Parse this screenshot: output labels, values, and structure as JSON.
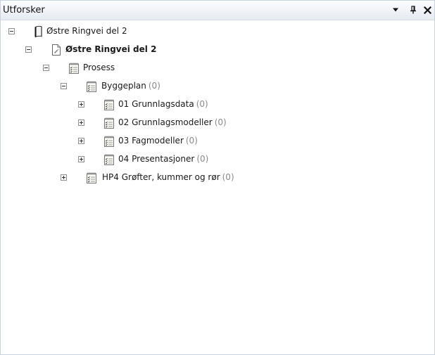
{
  "panel": {
    "title": "Utforsker",
    "icons": [
      "dropdown-arrow-icon",
      "pin-icon",
      "close-icon"
    ]
  },
  "tree": [
    {
      "name": "tree-node-ostre-ringvei-project",
      "label": "Østre Ringvei del 2",
      "count": "",
      "bold": false,
      "state": "expanded",
      "icon": "project-book-icon"
    },
    {
      "name": "tree-node-ostre-ringvei-document",
      "label": "Østre Ringvei del 2",
      "count": "",
      "bold": true,
      "state": "expanded",
      "icon": "document-icon"
    },
    {
      "name": "tree-node-prosess",
      "label": "Prosess",
      "count": "",
      "bold": false,
      "state": "expanded",
      "icon": "checklist-icon"
    },
    {
      "name": "tree-node-byggeplan",
      "label": "Byggeplan",
      "count": "(0)",
      "bold": false,
      "state": "expanded",
      "icon": "checklist-icon"
    },
    {
      "name": "tree-node-grunnlagsdata",
      "label": "01 Grunnlagsdata",
      "count": "(0)",
      "bold": false,
      "state": "collapsed",
      "icon": "checklist-icon"
    },
    {
      "name": "tree-node-grunnlagsmodeller",
      "label": "02 Grunnlagsmodeller",
      "count": "(0)",
      "bold": false,
      "state": "collapsed",
      "icon": "checklist-icon"
    },
    {
      "name": "tree-node-fagmodeller",
      "label": "03 Fagmodeller",
      "count": "(0)",
      "bold": false,
      "state": "collapsed",
      "icon": "checklist-icon"
    },
    {
      "name": "tree-node-presentasjoner",
      "label": "04 Presentasjoner",
      "count": "(0)",
      "bold": false,
      "state": "collapsed",
      "icon": "checklist-icon"
    },
    {
      "name": "tree-node-hp4",
      "label": "HP4 Grøfter, kummer og rør",
      "count": "(0)",
      "bold": false,
      "state": "collapsed",
      "icon": "checklist-icon"
    }
  ]
}
